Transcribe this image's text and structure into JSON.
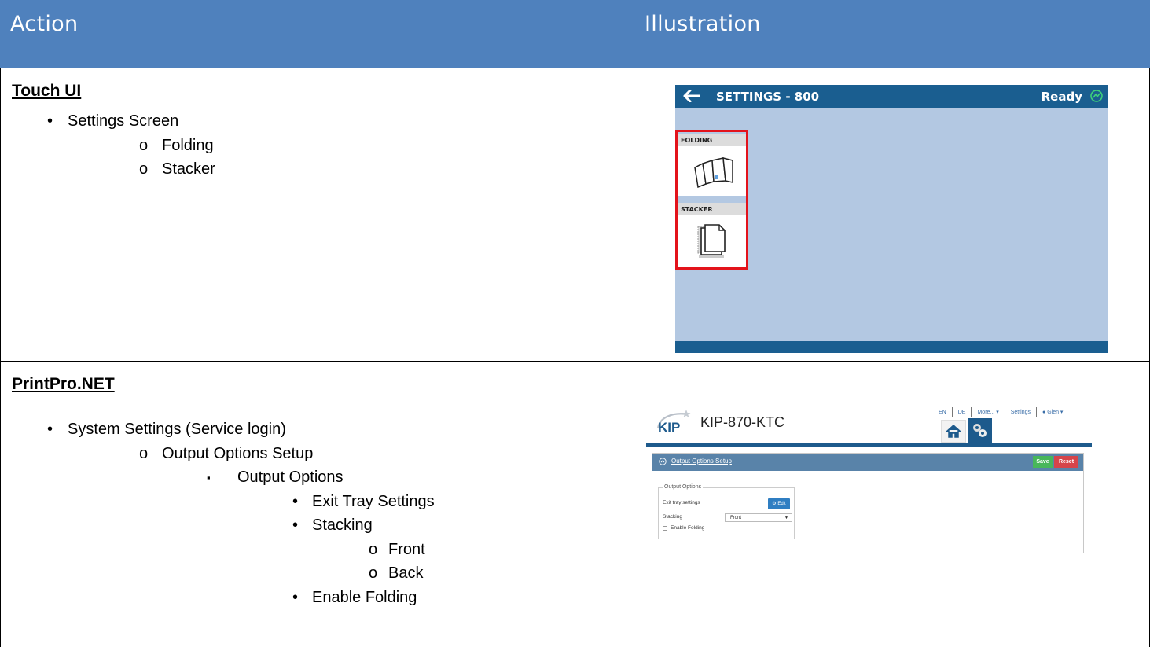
{
  "header": {
    "action": "Action",
    "illustration": "Illustration"
  },
  "row1": {
    "title": "Touch UI",
    "items": [
      {
        "level": 1,
        "bullet": "•",
        "text": "Settings Screen"
      },
      {
        "level": 2,
        "bullet": "o",
        "text": "Folding"
      },
      {
        "level": 2,
        "bullet": "o",
        "text": "Stacker"
      }
    ],
    "touch": {
      "title": "SETTINGS - 800",
      "status": "Ready",
      "tiles": [
        "FOLDING",
        "STACKER"
      ],
      "colors": {
        "bar": "#1a5e90",
        "background": "#b3c8e2",
        "highlight": "#e3131b"
      }
    }
  },
  "row2": {
    "title": "PrintPro.NET",
    "items": [
      {
        "level": 1,
        "bullet": "•",
        "text": "System Settings (Service login)"
      },
      {
        "level": 2,
        "bullet": "o",
        "text": "Output Options Setup"
      },
      {
        "level": 3,
        "bullet": "▪",
        "text": "Output Options"
      },
      {
        "level": 4,
        "bullet": "•",
        "text": "Exit Tray Settings"
      },
      {
        "level": 4,
        "bullet": "•",
        "text": "Stacking"
      },
      {
        "level": 5,
        "bullet": "o",
        "text": "Front"
      },
      {
        "level": 5,
        "bullet": "o",
        "text": "Back"
      },
      {
        "level": 4,
        "bullet": "•",
        "text": "Enable Folding"
      }
    ],
    "printpro": {
      "logo": "KIP",
      "model": "KIP-870-KTC",
      "nav": {
        "en": "EN",
        "de": "DE",
        "more": "More... ▾",
        "settings": "Settings",
        "user": "Glen ▾"
      },
      "panel_title": "Output Options Setup",
      "save": "Save",
      "reset": "Reset",
      "fieldset_legend": "Output Options",
      "exit_tray_label": "Exit tray settings",
      "edit": "⚙ Edit",
      "stacking_label": "Stacking",
      "stacking_value": "Front",
      "enable_folding": "Enable Folding"
    }
  }
}
